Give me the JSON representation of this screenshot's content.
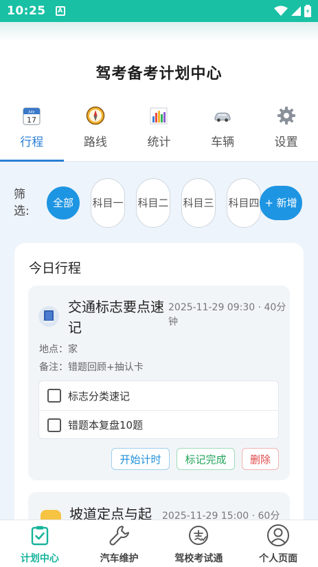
{
  "status_bar": {
    "time": "10:25",
    "notification_letter": "A"
  },
  "header": {
    "title": "驾考备考计划中心"
  },
  "tabs": [
    {
      "label": "行程",
      "icon": "calendar-icon",
      "active": true
    },
    {
      "label": "路线",
      "icon": "compass-icon",
      "active": false
    },
    {
      "label": "统计",
      "icon": "bar-chart-icon",
      "active": false
    },
    {
      "label": "车辆",
      "icon": "car-icon",
      "active": false
    },
    {
      "label": "设置",
      "icon": "gear-icon",
      "active": false
    }
  ],
  "calendar_icon_text": {
    "month": "July",
    "day": "17"
  },
  "filter": {
    "label": "筛选:",
    "chips": [
      "全部",
      "科目一",
      "科目二",
      "科目三",
      "科目四"
    ],
    "add_label": "+ 新增"
  },
  "today": {
    "title": "今日行程",
    "task1": {
      "name": "交通标志要点速记",
      "time": "2025-11-29 09:30 · 40分钟",
      "location": "地点：家",
      "note": "备注：错题回顾+抽认卡",
      "checklist": [
        "标志分类速记",
        "错题本复盘10题"
      ],
      "buttons": {
        "start": "开始计时",
        "done": "标记完成",
        "delete": "删除"
      }
    },
    "task2": {
      "name": "坡道定点与起",
      "time": "2025-11-29 15:00 · 60分"
    }
  },
  "bottom_nav": [
    {
      "label": "计划中心",
      "icon": "checklist-icon",
      "active": true
    },
    {
      "label": "汽车维护",
      "icon": "wrench-icon",
      "active": false
    },
    {
      "label": "驾校考试通",
      "icon": "exam-icon",
      "active": false
    },
    {
      "label": "个人页面",
      "icon": "user-icon",
      "active": false
    }
  ],
  "colors": {
    "status_bar": "#19c0a4",
    "accent_blue": "#1e95e2",
    "active_tab": "#2a7fd4",
    "active_nav": "#16b39a"
  }
}
